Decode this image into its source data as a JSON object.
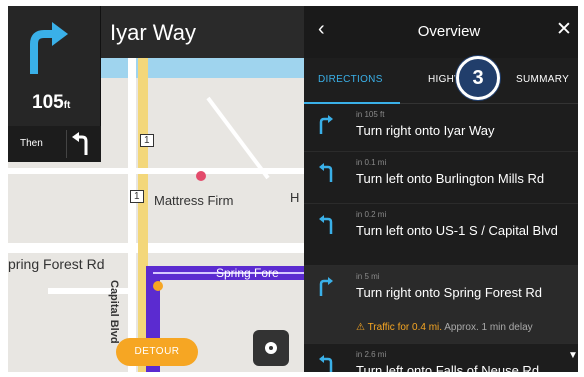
{
  "nav": {
    "street": "Iyar Way",
    "distance_value": "105",
    "distance_unit": "ft",
    "then_label": "Then"
  },
  "map": {
    "labels": {
      "mattress": "Mattress Firm",
      "spring_forest_left": "pring Forest Rd",
      "capital_blvd": "Capital Blvd",
      "spring_fore_road": "Spring Fore",
      "route_shield_1": "1",
      "route_shield_2": "1",
      "h": "H"
    },
    "detour_label": "DETOUR"
  },
  "panel": {
    "back": "‹",
    "title": "Overview",
    "close": "✕",
    "tabs": [
      "DIRECTIONS",
      "HIGHW",
      "SUMMARY"
    ],
    "badge": "3"
  },
  "steps": [
    {
      "dist": "in 105 ft",
      "text": "Turn right onto Iyar Way",
      "dir": "right-icon"
    },
    {
      "dist": "in 0.1 mi",
      "text": "Turn left onto Burlington Mills Rd",
      "dir": "left-icon"
    },
    {
      "dist": "in 0.2 mi",
      "text": "Turn left onto US-1 S / Capital Blvd",
      "dir": "left-icon"
    },
    {
      "dist": "in 5 mi",
      "text": "Turn right onto Spring Forest Rd",
      "dir": "right-icon",
      "traffic_warn": "Traffic for 0.4 mi.",
      "traffic_rest": "Approx. 1 min delay"
    },
    {
      "dist": "in 2.6 mi",
      "text": "Turn left onto Falls of Neuse Rd",
      "dir": "left-icon"
    }
  ],
  "colors": {
    "accent": "#3ab0e8",
    "route": "#5b2bd0",
    "warn": "#f6a623",
    "badge": "#213e6b"
  }
}
